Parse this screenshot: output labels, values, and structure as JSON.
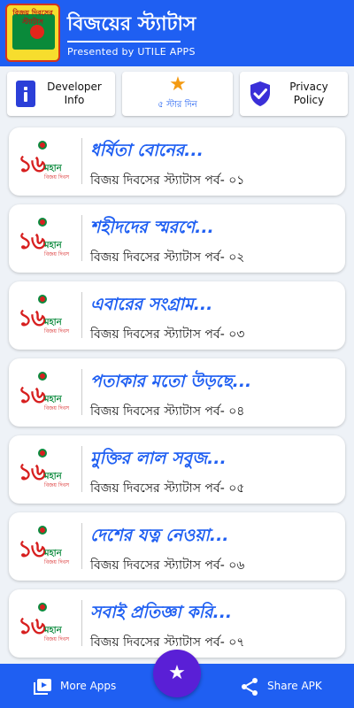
{
  "appbar": {
    "icon_text": "বিজয় দিবসের স্ট্যাটাস",
    "title": "বিজয়ের স্ট্যাটাস",
    "subtitle": "Presented by UTILE APPS"
  },
  "actions": {
    "developer_label": "Developer\nInfo",
    "rate_label": "৫ স্টার দিন",
    "privacy_label": "Privacy\nPolicy"
  },
  "logo": {
    "number": "১৬",
    "line1": "মহান",
    "line2": "বিজয় দিবস"
  },
  "items": [
    {
      "title": "ধর্ষিতা বোনের...",
      "subtitle": "বিজয় দিবসের স্ট্যাটাস পর্ব- ০১"
    },
    {
      "title": "শহীদদের স্মরণে...",
      "subtitle": "বিজয় দিবসের স্ট্যাটাস পর্ব- ০২"
    },
    {
      "title": "এবারের সংগ্রাম...",
      "subtitle": "বিজয় দিবসের স্ট্যাটাস পর্ব- ০৩"
    },
    {
      "title": "পতাকার মতো উড়ছে...",
      "subtitle": "বিজয় দিবসের স্ট্যাটাস পর্ব- ০৪"
    },
    {
      "title": "মুক্তির লাল সবুজ...",
      "subtitle": "বিজয় দিবসের স্ট্যাটাস পর্ব- ০৫"
    },
    {
      "title": "দেশের যত্ন নেওয়া...",
      "subtitle": "বিজয় দিবসের স্ট্যাটাস পর্ব- ০৬"
    },
    {
      "title": "সবাই প্রতিজ্ঞা করি...",
      "subtitle": "বিজয় দিবসের স্ট্যাটাস পর্ব- ০৭"
    }
  ],
  "bottombar": {
    "more_apps": "More Apps",
    "share_apk": "Share APK",
    "fab_icon": "star-icon"
  },
  "colors": {
    "primary": "#1f5ff2",
    "fab": "#5a1fd6",
    "star": "#f39a12"
  }
}
